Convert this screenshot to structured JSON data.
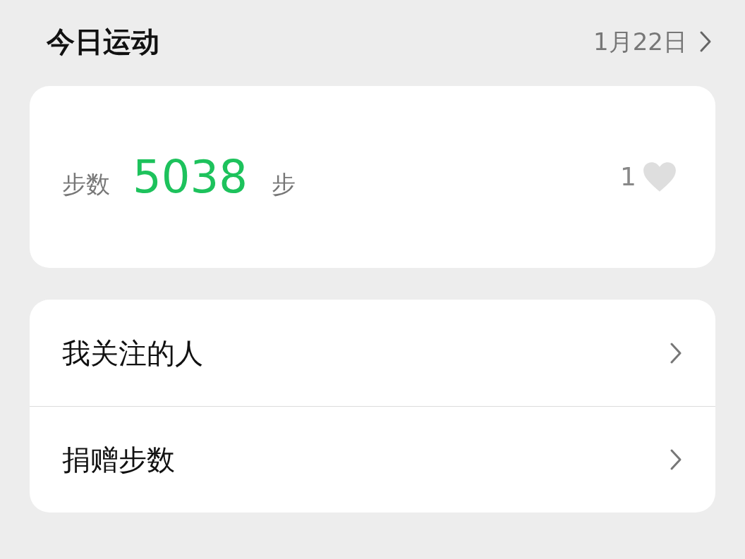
{
  "header": {
    "title": "今日运动",
    "date": "1月22日"
  },
  "steps": {
    "label": "步数",
    "value": "5038",
    "unit": "步",
    "likes": "1"
  },
  "menu": [
    {
      "label": "我关注的人"
    },
    {
      "label": "捐赠步数"
    }
  ]
}
